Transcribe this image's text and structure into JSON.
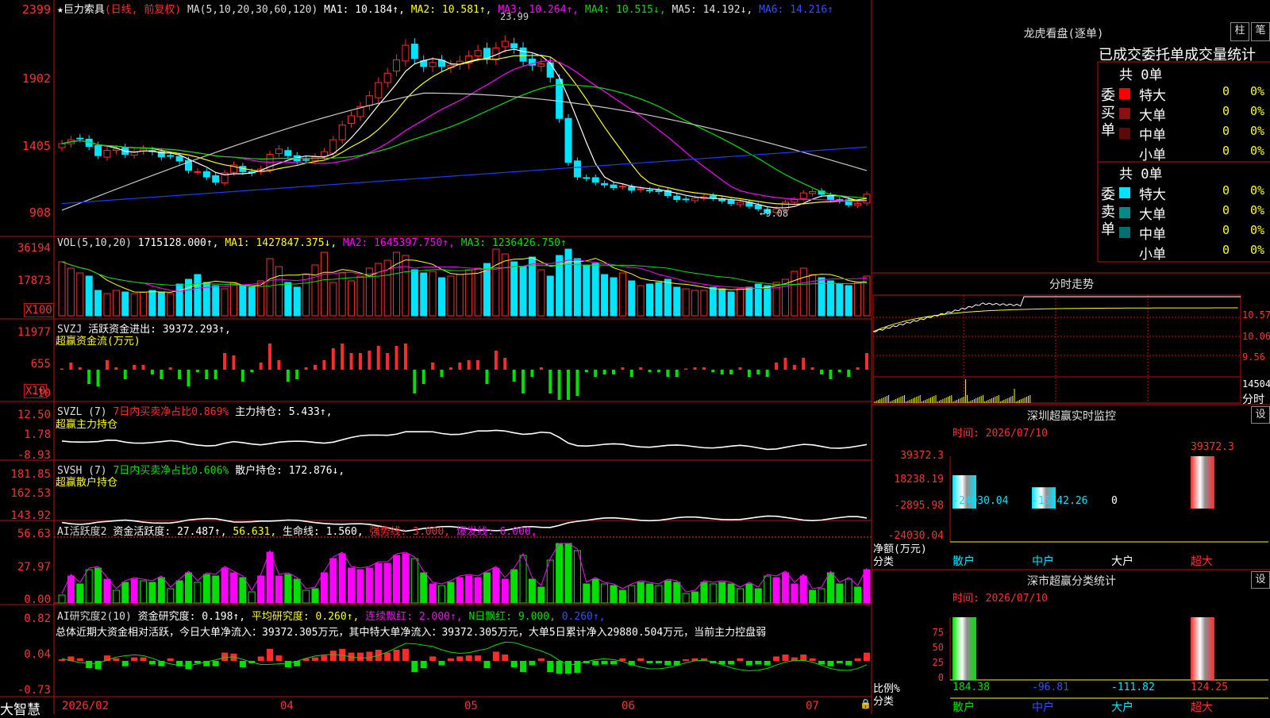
{
  "colors": {
    "up": "#ff2a2a",
    "down": "#00e5ff",
    "frame": "#c01010",
    "label": "#ff4040",
    "white": "#ffffff",
    "yellow": "#ffff00",
    "magenta": "#ff00ff",
    "green": "#00e000",
    "blue": "#1a3cff",
    "gray": "#c8c8c8",
    "orange": "#ff8040"
  },
  "price_chart": {
    "title": "★巨力索具",
    "mode": "(日线, 前复权)",
    "ma_spec": "MA(5,10,20,30,60,120)",
    "ma1": "MA1: 10.184↑,",
    "ma2": "MA2: 10.581↑,",
    "ma3": "MA3: 10.264↑,",
    "ma4": "MA4: 10.515↓,",
    "ma5": "MA5: 14.192↓,",
    "ma6": "MA6: 14.216↑",
    "y_ticks": [
      "2399",
      "1902",
      "1405",
      "908"
    ],
    "high_label": "23.99",
    "low_label": "←9.08",
    "close": [
      14.5,
      14.8,
      14.9,
      14.3,
      13.6,
      14.0,
      14.1,
      13.7,
      13.9,
      14.1,
      13.9,
      13.5,
      13.6,
      13.2,
      12.5,
      12.4,
      12.0,
      11.6,
      12.3,
      12.9,
      12.4,
      12.3,
      12.6,
      13.7,
      14.1,
      13.6,
      13.2,
      13.3,
      13.5,
      13.9,
      14.8,
      15.9,
      16.6,
      17.3,
      18.1,
      19.1,
      19.8,
      20.8,
      21.9,
      20.9,
      20.3,
      20.6,
      20.3,
      20.4,
      20.7,
      21.1,
      21.5,
      20.9,
      21.7,
      22.2,
      21.7,
      20.7,
      20.4,
      20.5,
      19.5,
      16.4,
      13.1,
      12.0,
      11.9,
      11.6,
      11.4,
      11.2,
      11.3,
      11.0,
      11.1,
      11.0,
      10.9,
      10.6,
      10.3,
      10.3,
      10.4,
      10.5,
      10.4,
      10.2,
      10.0,
      10.1,
      9.8,
      9.6,
      9.3,
      9.6,
      10.1,
      10.3,
      10.8,
      10.9,
      10.7,
      10.3,
      10.2,
      9.9,
      10.0,
      10.7
    ]
  },
  "vol_chart": {
    "label": "VOL(5,10,20)",
    "value": "1715128.000↑,",
    "ma1": "MA1: 1427847.375↓,",
    "ma2": "MA2: 1645397.750↑,",
    "ma3": "MA3: 1236426.750↑",
    "y_ticks": [
      "36194",
      "17873"
    ],
    "unit": "X100",
    "values": [
      34,
      30,
      27,
      25,
      16,
      14,
      16,
      15,
      14,
      15,
      16,
      15,
      14,
      20,
      23,
      26,
      21,
      19,
      17,
      21,
      19,
      18,
      22,
      36,
      31,
      21,
      18,
      26,
      32,
      40,
      21,
      27,
      22,
      25,
      30,
      33,
      35,
      40,
      38,
      29,
      27,
      28,
      24,
      25,
      26,
      29,
      30,
      33,
      42,
      39,
      34,
      31,
      37,
      29,
      25,
      38,
      42,
      36,
      32,
      33,
      26,
      24,
      27,
      22,
      19,
      20,
      21,
      23,
      18,
      17,
      16,
      16,
      18,
      17,
      15,
      17,
      18,
      20,
      19,
      21,
      23,
      28,
      30,
      26,
      24,
      22,
      20,
      19,
      21,
      25
    ]
  },
  "svzj": {
    "label": "SVZJ",
    "text": "活跃资金进出: 39372.293↑,",
    "subtitle": "超赢资金流(万元)",
    "y_ticks": [
      "11977",
      "655",
      "-10"
    ],
    "unit": "X10"
  },
  "svzl": {
    "label": "SVZL (7)",
    "text1": "7日内买卖净占比0.869%",
    "text2": "主力持仓: 5.433↑,",
    "subtitle": "超赢主力持仓",
    "y_ticks": [
      "12.50",
      "1.78",
      "-8.93"
    ]
  },
  "svsh": {
    "label": "SVSH (7)",
    "text1": "7日内买卖净占比0.606%",
    "text2": "散户持仓: 172.876↓,",
    "subtitle": "超赢散户持仓",
    "y_ticks": [
      "181.85",
      "162.53",
      "143.92"
    ]
  },
  "ai_active": {
    "label": "AI活跃度2",
    "text1": "资金活跃度: 27.487↑,",
    "text2": "56.631,",
    "text3": "生命线: 1.560,",
    "text4": "强势线: 3.000,",
    "text5": "爆发线: 6.000,",
    "y_ticks": [
      "56.63",
      "27.97",
      "0.00"
    ]
  },
  "ai_research": {
    "label": "AI研究度2(10)",
    "text1": "资金研究度: 0.198↑,",
    "text2": "平均研究度: 0.260↑,",
    "text3": "连续飘红: 2.000↑,",
    "text4": "N日飘红: 9.000,",
    "text5": "0.260↑,",
    "summary": "总体近期大资金相对活跃，今日大单净流入：39372.305万元，其中特大单净流入：39372.305万元，大单5日累计净入29880.504万元，当前主力控盘弱",
    "y_ticks": [
      "0.82",
      "0.04",
      "-0.73"
    ]
  },
  "xaxis": {
    "brand": "大智慧",
    "dates": [
      "2026/02",
      "04",
      "05",
      "06",
      "07"
    ]
  },
  "dragon_tiger": {
    "title": "龙虎看盘(逐单)",
    "btn1": "柱",
    "btn2": "笔",
    "header": "已成交委托单成交量统计",
    "buy": {
      "side": "委买单",
      "total": "共 0单",
      "rows": [
        {
          "name": "特大",
          "v": "0",
          "p": "0%",
          "color": "#ff0000"
        },
        {
          "name": "大单",
          "v": "0",
          "p": "0%",
          "color": "#8b1010"
        },
        {
          "name": "中单",
          "v": "0",
          "p": "0%",
          "color": "#600808"
        },
        {
          "name": "小单",
          "v": "0",
          "p": "0%",
          "color": ""
        }
      ]
    },
    "sell": {
      "side": "委卖单",
      "total": "共 0单",
      "rows": [
        {
          "name": "特大",
          "v": "0",
          "p": "0%",
          "color": "#00e5ff"
        },
        {
          "name": "大单",
          "v": "0",
          "p": "0%",
          "color": "#008b8b"
        },
        {
          "name": "中单",
          "v": "0",
          "p": "0%",
          "color": "#007070"
        },
        {
          "name": "小单",
          "v": "0",
          "p": "0%",
          "color": ""
        }
      ]
    }
  },
  "intraday": {
    "title": "分时走势",
    "y_ticks": [
      "10.57",
      "10.06",
      "9.56"
    ],
    "vol_label": "14504",
    "bottom_label": "分时"
  },
  "sz_monitor": {
    "title": "深圳超赢实时监控",
    "btn": "设",
    "time": "时间: 2026/07/10",
    "y_ticks": [
      "39372.3",
      "18238.19",
      "-2895.98",
      "-24030.04"
    ],
    "ylabel": "净额(万元)",
    "xlabel": "分类",
    "bars": [
      {
        "cat": "散户",
        "value": -24030.04,
        "label": "-24030.04"
      },
      {
        "cat": "中户",
        "value": -15342.26,
        "label": "-15342.26"
      },
      {
        "cat": "大户",
        "value": 0,
        "label": "0"
      },
      {
        "cat": "超大",
        "value": 39372.3,
        "label": "39372.3"
      }
    ]
  },
  "sz_class": {
    "title": "深市超赢分类统计",
    "btn": "设",
    "time": "时间: 2026/07/10",
    "y_ticks": [
      "75",
      "50",
      "25",
      "0"
    ],
    "ylabel": "比例%",
    "xlabel": "分类",
    "bars": [
      {
        "cat": "散户",
        "value": 100,
        "label": "184.38"
      },
      {
        "cat": "中户",
        "value": 0,
        "label": "-96.81"
      },
      {
        "cat": "大户",
        "value": 0,
        "label": "-111.82"
      },
      {
        "cat": "超大",
        "value": 100,
        "label": "124.25"
      }
    ]
  }
}
